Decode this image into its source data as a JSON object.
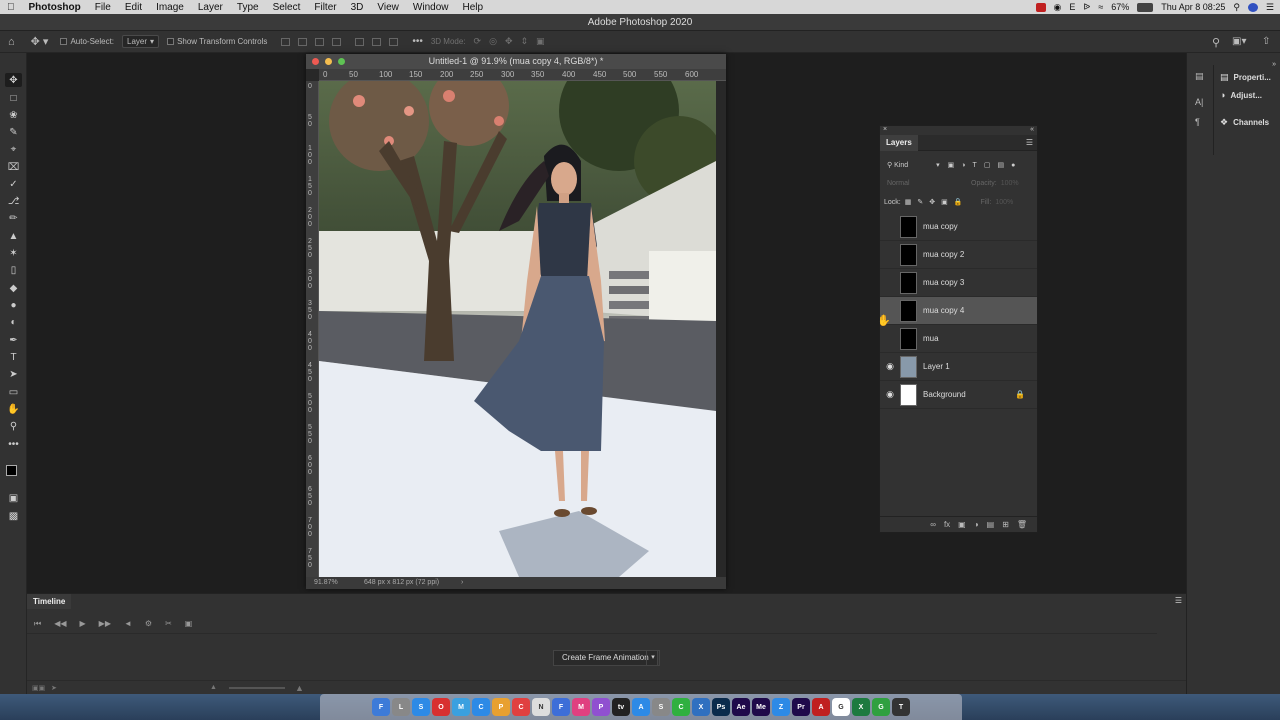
{
  "menubar": {
    "app": "Photoshop",
    "menus": [
      "File",
      "Edit",
      "Image",
      "Layer",
      "Type",
      "Select",
      "Filter",
      "3D",
      "View",
      "Window",
      "Help"
    ],
    "battery": "67%",
    "clock": "Thu Apr 8  08:25"
  },
  "window_title": "Adobe Photoshop 2020",
  "options": {
    "auto_select_label": "Auto-Select:",
    "auto_select_value": "Layer",
    "transform_label": "Show Transform Controls",
    "mode_label": "3D Mode:"
  },
  "document": {
    "title": "Untitled-1 @ 91.9% (mua copy 4, RGB/8*) *",
    "ruler_top": [
      "0",
      "50",
      "100",
      "150",
      "200",
      "250",
      "300",
      "350",
      "400",
      "450",
      "500",
      "550",
      "600"
    ],
    "ruler_left": [
      "0",
      "5\n0",
      "1\n0\n0",
      "1\n5\n0",
      "2\n0\n0",
      "2\n5\n0",
      "3\n0\n0",
      "3\n5\n0",
      "4\n0\n0",
      "4\n5\n0",
      "5\n0\n0",
      "5\n5\n0",
      "6\n0\n0",
      "6\n5\n0",
      "7\n0\n0",
      "7\n5\n0"
    ],
    "zoom": "91.87%",
    "info": "648 px x 812 px (72 ppi)"
  },
  "right_dock": {
    "items": [
      "Properti...",
      "Adjust...",
      "Channels"
    ]
  },
  "layers_panel": {
    "title": "Layers",
    "filter_kind": "Kind",
    "blend_mode": "Normal",
    "opacity_label": "Opacity:",
    "opacity_value": "100%",
    "lock_label": "Lock:",
    "fill_label": "Fill:",
    "fill_value": "100%",
    "layers": [
      {
        "name": "mua copy",
        "visible": false,
        "thumb": "#000000",
        "selected": false
      },
      {
        "name": "mua copy 2",
        "visible": false,
        "thumb": "#000000",
        "selected": false
      },
      {
        "name": "mua copy 3",
        "visible": false,
        "thumb": "#000000",
        "selected": false
      },
      {
        "name": "mua copy 4",
        "visible": false,
        "thumb": "#000000",
        "selected": true
      },
      {
        "name": "mua",
        "visible": false,
        "thumb": "#000000",
        "selected": false
      },
      {
        "name": "Layer 1",
        "visible": true,
        "thumb": "#8899aa",
        "selected": false
      },
      {
        "name": "Background",
        "visible": true,
        "thumb": "#ffffff",
        "selected": false,
        "locked": true
      }
    ]
  },
  "timeline": {
    "title": "Timeline",
    "create_button": "Create Frame Animation"
  },
  "dock_apps": [
    {
      "label": "F",
      "color": "#3d7bd8"
    },
    {
      "label": "L",
      "color": "#888888"
    },
    {
      "label": "S",
      "color": "#2d8ae6"
    },
    {
      "label": "O",
      "color": "#d83030"
    },
    {
      "label": "M",
      "color": "#3aa0e0"
    },
    {
      "label": "C",
      "color": "#2d8ae6"
    },
    {
      "label": "P",
      "color": "#e8a030"
    },
    {
      "label": "C",
      "color": "#e04040"
    },
    {
      "label": "N",
      "color": "#dddddd"
    },
    {
      "label": "F",
      "color": "#3d6ed8"
    },
    {
      "label": "M",
      "color": "#e04080"
    },
    {
      "label": "P",
      "color": "#9050d0"
    },
    {
      "label": "tv",
      "color": "#222222"
    },
    {
      "label": "A",
      "color": "#2d8ae6"
    },
    {
      "label": "S",
      "color": "#888888"
    },
    {
      "label": "C",
      "color": "#30b040"
    },
    {
      "label": "X",
      "color": "#3070c0"
    },
    {
      "label": "Ps",
      "color": "#0b2b4c"
    },
    {
      "label": "Ae",
      "color": "#1f0a4a"
    },
    {
      "label": "Me",
      "color": "#1f0a4a"
    },
    {
      "label": "Z",
      "color": "#2d8ae6"
    },
    {
      "label": "Pr",
      "color": "#1f0a4a"
    },
    {
      "label": "A",
      "color": "#c02020"
    },
    {
      "label": "G",
      "color": "#ffffff"
    },
    {
      "label": "X",
      "color": "#1d7a3f"
    },
    {
      "label": "G",
      "color": "#30a040"
    },
    {
      "label": "T",
      "color": "#333333"
    }
  ]
}
